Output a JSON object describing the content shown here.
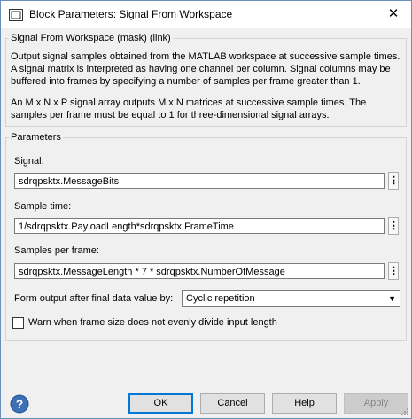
{
  "window": {
    "title": "Block Parameters: Signal From Workspace",
    "close_glyph": "✕"
  },
  "mask": {
    "group_title": "Signal From Workspace (mask) (link)",
    "description_lines_1": [
      "Output signal samples obtained from the MATLAB workspace at successive sample times.",
      "A signal matrix is interpreted as having one channel per column.  Signal columns may be",
      "buffered into frames by specifying a number of samples per frame greater than 1."
    ],
    "description_lines_2": [
      "An M x N x P signal array outputs M x N matrices at successive sample times.  The",
      "samples per frame must be equal to 1 for three-dimensional signal arrays."
    ]
  },
  "parameters": {
    "group_title": "Parameters",
    "signal_label": "Signal:",
    "signal_value": "sdrqpsktx.MessageBits",
    "sample_time_label": "Sample time:",
    "sample_time_value": "1/sdrqpsktx.PayloadLength*sdrqpsktx.FrameTime",
    "samples_per_frame_label": "Samples per frame:",
    "samples_per_frame_value": "sdrqpsktx.MessageLength * 7 * sdrqpsktx.NumberOfMessage",
    "more_glyph": "⋮",
    "form_output_label": "Form output after final data value by:",
    "form_output_selected": "Cyclic repetition",
    "warn_label": "Warn when frame size does not evenly divide input length",
    "warn_checked": false
  },
  "buttons": {
    "ok": "OK",
    "cancel": "Cancel",
    "help": "Help",
    "apply": "Apply"
  },
  "colors": {
    "accent": "#0078d7",
    "help_icon": "#3c6fb4"
  },
  "icons": {
    "app": "simulink-block-icon",
    "help": "help-question-icon"
  }
}
